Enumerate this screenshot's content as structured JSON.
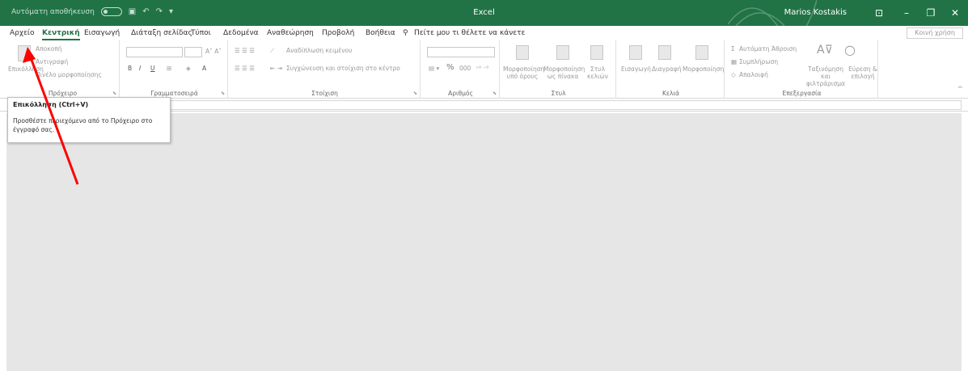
{
  "titlebar": {
    "autosave_label": "Αυτόματη αποθήκευση",
    "app_name": "Excel",
    "user_name": "Marios Kostakis"
  },
  "tabs": [
    {
      "label": "Αρχείο"
    },
    {
      "label": "Κεντρική",
      "active": true
    },
    {
      "label": "Εισαγωγή"
    },
    {
      "label": "Διάταξη σελίδας"
    },
    {
      "label": "Τύποι"
    },
    {
      "label": "Δεδομένα"
    },
    {
      "label": "Αναθεώρηση"
    },
    {
      "label": "Προβολή"
    },
    {
      "label": "Βοήθεια"
    }
  ],
  "tell_me": "Πείτε μου τι θέλετε να κάνετε",
  "share_label": "Κοινή χρήση",
  "ribbon": {
    "clipboard": {
      "paste": "Επικόλληση",
      "cut": "Αποκοπή",
      "copy": "Αντιγραφή",
      "format_painter": "Πινέλο μορφοποίησης",
      "label": "Πρόχειρο"
    },
    "font": {
      "label": "Γραμματοσειρά"
    },
    "alignment": {
      "wrap": "Αναδίπλωση κειμένου",
      "merge": "Συγχώνευση και στοίχιση στο κέντρο",
      "label": "Στοίχιση"
    },
    "number": {
      "label": "Αριθμός"
    },
    "styles": {
      "conditional": "Μορφοποίηση υπό όρους",
      "table": "Μορφοποίηση ως πίνακα",
      "cell": "Στυλ κελιών",
      "label": "Στυλ"
    },
    "cells": {
      "insert": "Εισαγωγή",
      "delete": "Διαγραφή",
      "format": "Μορφοποίηση",
      "label": "Κελιά"
    },
    "editing": {
      "autosum": "Αυτόματη Άθροιση",
      "fill": "Συμπλήρωση",
      "clear": "Απαλοιφή",
      "sort": "Ταξινόμηση και φιλτράρισμα",
      "find": "Εύρεση & επιλογή",
      "label": "Επεξεργασία"
    }
  },
  "tooltip": {
    "title": "Επικόλληση (Ctrl+V)",
    "body": "Προσθέστε περιεχόμενο από το Πρόχειρο στο έγγραφό σας."
  },
  "colors": {
    "excel_green": "#217346",
    "workspace_gray": "#e6e6e6",
    "annotation_arrow": "#ff0000"
  }
}
